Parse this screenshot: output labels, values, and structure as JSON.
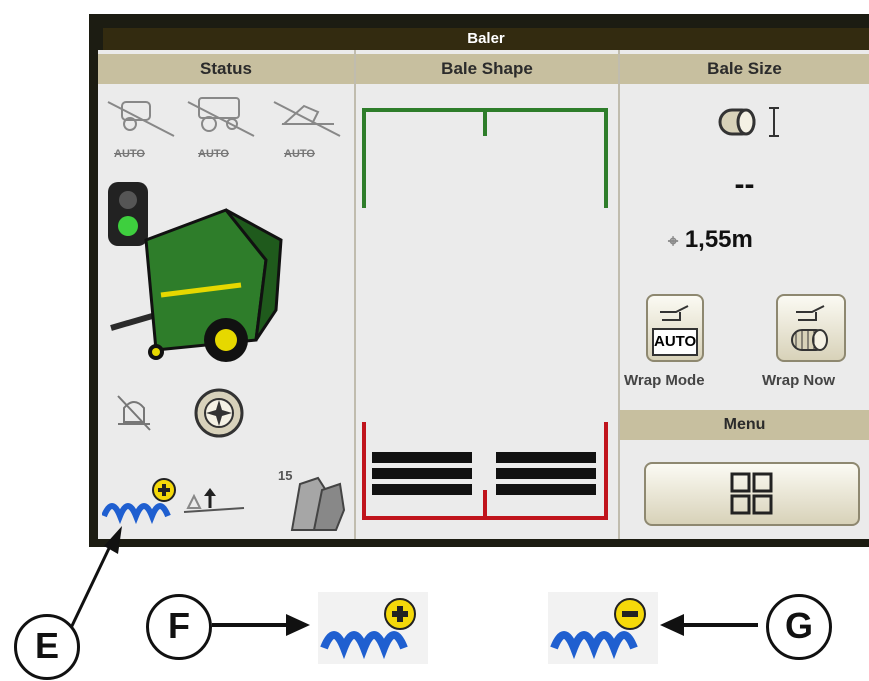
{
  "window": {
    "title": "Baler"
  },
  "status": {
    "header": "Status",
    "auto_labels": [
      "AUTO",
      "AUTO",
      "AUTO"
    ],
    "bale_count": "15"
  },
  "bale_shape": {
    "header": "Bale Shape"
  },
  "bale_size": {
    "header": "Bale Size",
    "value": "--",
    "target": "1,55m",
    "wrap_mode": {
      "label": "Wrap Mode",
      "badge": "AUTO"
    },
    "wrap_now": {
      "label": "Wrap Now"
    },
    "menu_header": "Menu"
  },
  "callouts": {
    "e": "E",
    "f": "F",
    "g": "G"
  },
  "colors": {
    "title_bar": "#332b10",
    "header": "#c7bf9f",
    "green": "#2e7d2a",
    "red": "#c0141c",
    "blue": "#1f5fd0",
    "yellow": "#f5d90a"
  }
}
